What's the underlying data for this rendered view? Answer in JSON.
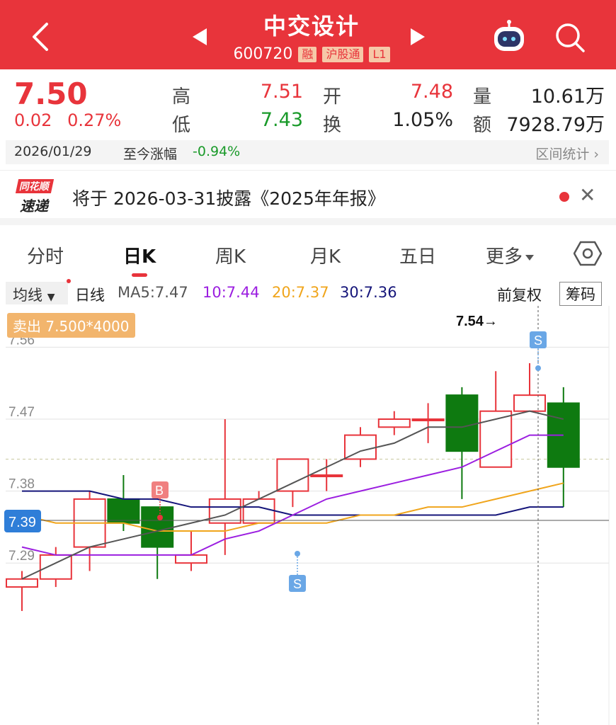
{
  "header": {
    "title": "中交设计",
    "code": "600720",
    "tags": [
      "融",
      "沪股通",
      "L1"
    ]
  },
  "quote": {
    "price": "7.50",
    "change": "0.02",
    "change_pct": "0.27%",
    "high_label": "高",
    "high": "7.51",
    "low_label": "低",
    "low": "7.43",
    "open_label": "开",
    "open": "7.48",
    "turnover_label": "换",
    "turnover": "1.05%",
    "volume_label": "量",
    "volume": "10.61万",
    "amount_label": "额",
    "amount": "7928.79万"
  },
  "date_bar": {
    "date": "2026/01/29",
    "since_label": "至今涨幅",
    "since_value": "-0.94%",
    "range_stats": "区间统计"
  },
  "news": {
    "logo_top": "同花顺",
    "logo_bottom": "速递",
    "text": "将于 2026-03-31披露《2025年年报》"
  },
  "tabs": [
    "分时",
    "日K",
    "周K",
    "月K",
    "五日",
    "更多"
  ],
  "ma": {
    "selector": "均线",
    "period": "日线",
    "ma5": "MA5:7.47",
    "ma10": "10:7.44",
    "ma20": "20:7.37",
    "ma30": "30:7.36",
    "adjust": "前复权",
    "chips": "筹码"
  },
  "chart_labels": {
    "sell_order": "卖出 7.500*4000",
    "max_label": "7.54→",
    "current": "7.39",
    "buy_mark": "B",
    "sell_mark": "S"
  },
  "colors": {
    "up": "#e8343b",
    "down": "#0e7a10",
    "ma5": "#555555",
    "ma10": "#9b1ee0",
    "ma20": "#f0a51c",
    "ma30": "#15157a"
  },
  "chart_data": {
    "type": "candlestick",
    "y_ticks": [
      7.29,
      7.38,
      7.47,
      7.56
    ],
    "candles": [
      {
        "open": 7.26,
        "high": 7.28,
        "low": 7.23,
        "close": 7.27
      },
      {
        "open": 7.27,
        "high": 7.31,
        "low": 7.26,
        "close": 7.3
      },
      {
        "open": 7.31,
        "high": 7.38,
        "low": 7.28,
        "close": 7.37
      },
      {
        "open": 7.37,
        "high": 7.4,
        "low": 7.33,
        "close": 7.34
      },
      {
        "open": 7.36,
        "high": 7.36,
        "low": 7.27,
        "close": 7.31
      },
      {
        "open": 7.29,
        "high": 7.33,
        "low": 7.28,
        "close": 7.3
      },
      {
        "open": 7.34,
        "high": 7.47,
        "low": 7.3,
        "close": 7.37
      },
      {
        "open": 7.34,
        "high": 7.38,
        "low": 7.34,
        "close": 7.37
      },
      {
        "open": 7.38,
        "high": 7.42,
        "low": 7.36,
        "close": 7.42
      },
      {
        "open": 7.4,
        "high": 7.42,
        "low": 7.38,
        "close": 7.4
      },
      {
        "open": 7.42,
        "high": 7.46,
        "low": 7.41,
        "close": 7.45
      },
      {
        "open": 7.46,
        "high": 7.48,
        "low": 7.45,
        "close": 7.47
      },
      {
        "open": 7.47,
        "high": 7.49,
        "low": 7.44,
        "close": 7.47
      },
      {
        "open": 7.5,
        "high": 7.51,
        "low": 7.37,
        "close": 7.43
      },
      {
        "open": 7.41,
        "high": 7.53,
        "low": 7.41,
        "close": 7.48
      },
      {
        "open": 7.48,
        "high": 7.54,
        "low": 7.48,
        "close": 7.5
      },
      {
        "open": 7.49,
        "high": 7.51,
        "low": 7.36,
        "close": 7.41
      }
    ],
    "ma5": [
      7.27,
      7.29,
      7.31,
      7.32,
      7.33,
      7.34,
      7.35,
      7.37,
      7.39,
      7.41,
      7.43,
      7.44,
      7.46,
      7.46,
      7.47,
      7.48,
      7.47
    ],
    "ma10": [
      7.31,
      7.3,
      7.3,
      7.3,
      7.3,
      7.3,
      7.32,
      7.33,
      7.35,
      7.37,
      7.38,
      7.39,
      7.4,
      7.41,
      7.43,
      7.45,
      7.45
    ],
    "ma20": [
      7.35,
      7.34,
      7.34,
      7.34,
      7.33,
      7.33,
      7.33,
      7.34,
      7.34,
      7.34,
      7.35,
      7.35,
      7.36,
      7.36,
      7.37,
      7.38,
      7.39
    ],
    "ma30": [
      7.38,
      7.38,
      7.38,
      7.37,
      7.37,
      7.36,
      7.36,
      7.36,
      7.35,
      7.35,
      7.35,
      7.35,
      7.35,
      7.35,
      7.35,
      7.36,
      7.36
    ]
  }
}
